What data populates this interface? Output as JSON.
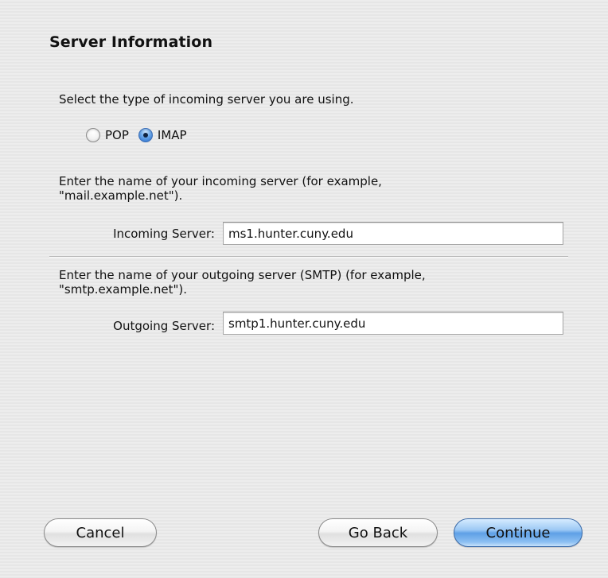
{
  "dialog": {
    "title": "Server Information"
  },
  "server_type": {
    "prompt": "Select the type of incoming server you are using.",
    "options": [
      {
        "label": "POP",
        "selected": false
      },
      {
        "label": "IMAP",
        "selected": true
      }
    ]
  },
  "incoming": {
    "instructions_line1": "Enter the name of your incoming server (for example,",
    "instructions_line2": "\"mail.example.net\").",
    "label": "Incoming Server:",
    "value": "ms1.hunter.cuny.edu"
  },
  "outgoing": {
    "instructions_line1": "Enter the name of your outgoing server (SMTP) (for example,",
    "instructions_line2": "\"smtp.example.net\").",
    "label": "Outgoing Server:",
    "value": "smtp1.hunter.cuny.edu"
  },
  "buttons": {
    "cancel": "Cancel",
    "go_back": "Go Back",
    "continue": "Continue"
  },
  "colors": {
    "primary_button": "#5ea0e6",
    "selected_radio": "#2b6fcd",
    "background": "#ececec"
  }
}
